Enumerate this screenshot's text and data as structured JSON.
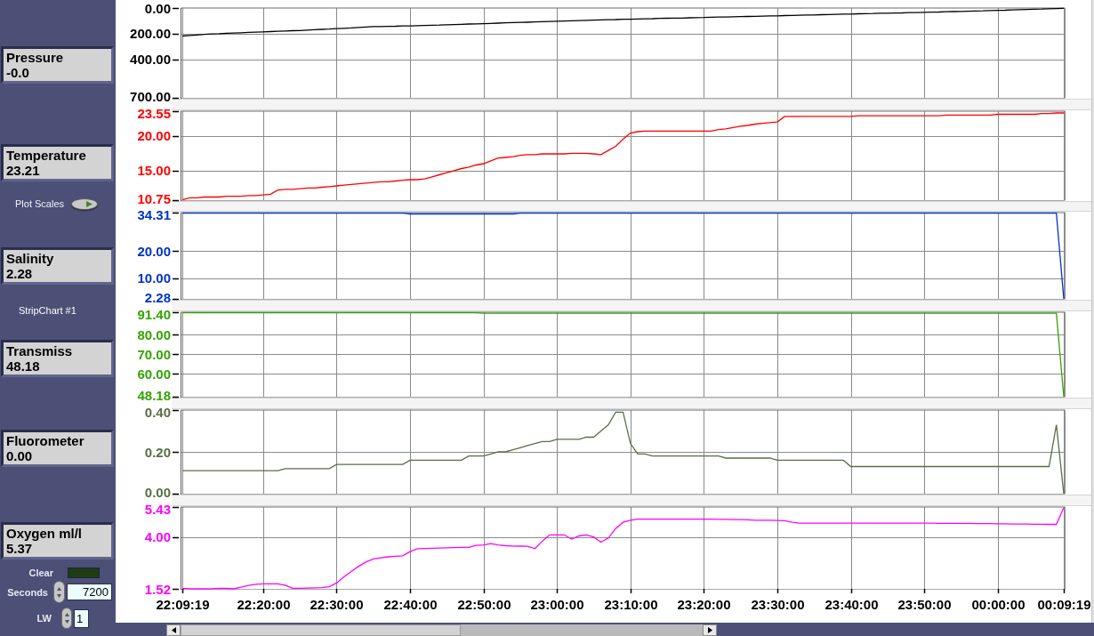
{
  "panel": {
    "items": [
      {
        "kind": "indicator",
        "label": "Pressure",
        "value": "-0.0"
      },
      {
        "kind": "indicator",
        "label": "Temperature",
        "value": "23.21"
      },
      {
        "kind": "button",
        "label": "Plot Scales"
      },
      {
        "kind": "indicator",
        "label": "Salinity",
        "value": "2.28"
      },
      {
        "kind": "caption",
        "text": "StripChart #1"
      },
      {
        "kind": "indicator",
        "label": "Transmiss",
        "value": "48.18"
      },
      {
        "kind": "indicator",
        "label": "Fluorometer",
        "value": "0.00"
      },
      {
        "kind": "indicator",
        "label": "Oxygen ml/l",
        "value": "5.37"
      },
      {
        "kind": "led",
        "label": "Clear",
        "on": false
      },
      {
        "kind": "numeric",
        "label": "Seconds",
        "value": "7200"
      },
      {
        "kind": "numeric",
        "label": "LW",
        "value": "1"
      }
    ]
  },
  "strip_chart": {
    "strips": [
      {
        "chart_data": {
          "type": "line",
          "grid": true,
          "categories": [
            null,
            null,
            null,
            null,
            null,
            null,
            null,
            null,
            null,
            null,
            null,
            null,
            null,
            null,
            null,
            null,
            null,
            null,
            null,
            null,
            null,
            null,
            null,
            null,
            null,
            null,
            null,
            null,
            null,
            null,
            null,
            null,
            null,
            null,
            null,
            null,
            null,
            null,
            null,
            null,
            null,
            null,
            null,
            null,
            null,
            null,
            null,
            null,
            null,
            null,
            null,
            null,
            null,
            null,
            null,
            null,
            null,
            null,
            null,
            null,
            null,
            null,
            null,
            null,
            null,
            null,
            null,
            null,
            null,
            null,
            null,
            null,
            null,
            null,
            null,
            null,
            null,
            null,
            null,
            null,
            null,
            null,
            null,
            null,
            null,
            null,
            null,
            null,
            null,
            null,
            null,
            null,
            null,
            null,
            null,
            null,
            null,
            null,
            null,
            null,
            null,
            null,
            null,
            null,
            null,
            null,
            null,
            null,
            null,
            null,
            null,
            null,
            null,
            null,
            null,
            null,
            null,
            null,
            null,
            null,
            null
          ],
          "series": [
            {
              "color": "#000000",
              "values": [
                218,
                214,
                210,
                206,
                202,
                200,
                197,
                195,
                193,
                190,
                188,
                186,
                184,
                181,
                179,
                177,
                175,
                172,
                169,
                166,
                164,
                161,
                158,
                155,
                151,
                148,
                145,
                144,
                143,
                142,
                140,
                139,
                138,
                136,
                134,
                133,
                131,
                129,
                127,
                125,
                124,
                122,
                120,
                118,
                116,
                114,
                112,
                111,
                109,
                107,
                105,
                103,
                102,
                100,
                98,
                96,
                95,
                93,
                91,
                90,
                88,
                87,
                85,
                84,
                83,
                81,
                80,
                79,
                78,
                76,
                75,
                74,
                72,
                71,
                70,
                68,
                67,
                66,
                65,
                63,
                62,
                61,
                59,
                58,
                56,
                55,
                54,
                52,
                51,
                49,
                48,
                47,
                45,
                44,
                43,
                41,
                40,
                39,
                38,
                36,
                35,
                34,
                32,
                31,
                29,
                28,
                26,
                25,
                23,
                22,
                20,
                18,
                17,
                15,
                13,
                11,
                9,
                8,
                6,
                4,
                2
              ]
            }
          ],
          "ylim": [
            700,
            0
          ],
          "yticks": [
            {
              "value": 0,
              "label": "0.00"
            },
            {
              "value": 200,
              "label": "200.00"
            },
            {
              "value": 400,
              "label": "400.00"
            },
            {
              "value": 700,
              "label": "700.00"
            }
          ]
        }
      },
      {
        "chart_data": {
          "type": "line",
          "grid": true,
          "categories": [
            null,
            null,
            null,
            null,
            null,
            null,
            null,
            null,
            null,
            null,
            null,
            null,
            null,
            null,
            null,
            null,
            null,
            null,
            null,
            null,
            null,
            null,
            null,
            null,
            null,
            null,
            null,
            null,
            null,
            null,
            null,
            null,
            null,
            null,
            null,
            null,
            null,
            null,
            null,
            null,
            null,
            null,
            null,
            null,
            null,
            null,
            null,
            null,
            null,
            null,
            null,
            null,
            null,
            null,
            null,
            null,
            null,
            null,
            null,
            null,
            null,
            null,
            null,
            null,
            null,
            null,
            null,
            null,
            null,
            null,
            null,
            null,
            null,
            null,
            null,
            null,
            null,
            null,
            null,
            null,
            null,
            null,
            null,
            null,
            null,
            null,
            null,
            null,
            null,
            null,
            null,
            null,
            null,
            null,
            null,
            null,
            null,
            null,
            null,
            null,
            null,
            null,
            null,
            null,
            null,
            null,
            null,
            null,
            null,
            null,
            null,
            null,
            null,
            null,
            null,
            null,
            null,
            null,
            null,
            null,
            null
          ],
          "series": [
            {
              "color": "#ff0000",
              "values": [
                10.8,
                11.1,
                11.1,
                11.2,
                11.2,
                11.2,
                11.3,
                11.3,
                11.3,
                11.4,
                11.4,
                11.5,
                11.6,
                12.2,
                12.3,
                12.3,
                12.4,
                12.5,
                12.5,
                12.6,
                12.7,
                12.8,
                12.9,
                13.0,
                13.1,
                13.2,
                13.3,
                13.4,
                13.4,
                13.5,
                13.6,
                13.7,
                13.7,
                13.8,
                14.1,
                14.4,
                14.7,
                15.0,
                15.3,
                15.5,
                15.8,
                16.0,
                16.4,
                16.8,
                16.9,
                17.0,
                17.2,
                17.3,
                17.3,
                17.4,
                17.4,
                17.4,
                17.4,
                17.5,
                17.5,
                17.5,
                17.4,
                17.3,
                17.9,
                18.5,
                19.5,
                20.4,
                20.6,
                20.7,
                20.7,
                20.7,
                20.7,
                20.7,
                20.7,
                20.7,
                20.7,
                20.7,
                20.7,
                20.9,
                21.0,
                21.2,
                21.4,
                21.5,
                21.7,
                21.8,
                21.9,
                22.0,
                22.8,
                22.8,
                22.8,
                22.8,
                22.8,
                22.8,
                22.8,
                22.8,
                22.8,
                22.8,
                22.9,
                22.9,
                22.9,
                22.9,
                22.9,
                22.9,
                22.9,
                22.9,
                22.9,
                22.9,
                22.9,
                22.9,
                23.0,
                23.0,
                23.0,
                23.0,
                23.0,
                23.0,
                23.0,
                23.1,
                23.1,
                23.1,
                23.1,
                23.1,
                23.1,
                23.2,
                23.2,
                23.3,
                23.3
              ]
            }
          ],
          "ylim": [
            10.75,
            23.55
          ],
          "yticks": [
            {
              "value": 23.55,
              "label": "23.55"
            },
            {
              "value": 20,
              "label": "20.00"
            },
            {
              "value": 15,
              "label": "15.00"
            },
            {
              "value": 10.75,
              "label": "10.75"
            }
          ]
        }
      },
      {
        "chart_data": {
          "type": "line",
          "grid": true,
          "categories": [
            null,
            null,
            null,
            null,
            null,
            null,
            null,
            null,
            null,
            null,
            null,
            null,
            null,
            null,
            null,
            null,
            null,
            null,
            null,
            null,
            null,
            null,
            null,
            null,
            null,
            null,
            null,
            null,
            null,
            null,
            null,
            null,
            null,
            null,
            null,
            null,
            null,
            null,
            null,
            null,
            null,
            null,
            null,
            null,
            null,
            null,
            null,
            null,
            null,
            null,
            null,
            null,
            null,
            null,
            null,
            null,
            null,
            null,
            null,
            null,
            null,
            null,
            null,
            null,
            null,
            null,
            null,
            null,
            null,
            null,
            null,
            null,
            null,
            null,
            null,
            null,
            null,
            null,
            null,
            null,
            null,
            null,
            null,
            null,
            null,
            null,
            null,
            null,
            null,
            null,
            null,
            null,
            null,
            null,
            null,
            null,
            null,
            null,
            null,
            null,
            null,
            null,
            null,
            null,
            null,
            null,
            null,
            null,
            null,
            null,
            null,
            null,
            null,
            null,
            null,
            null,
            null,
            null,
            null,
            null,
            null
          ],
          "series": [
            {
              "color": "#0033cc",
              "values": [
                34.1,
                34.1,
                34.1,
                34.1,
                34.1,
                34.1,
                34.1,
                34.1,
                34.1,
                34.1,
                34.1,
                34.1,
                34.1,
                34.1,
                34.1,
                34.1,
                34.1,
                34.1,
                34.1,
                34.1,
                34.1,
                34.1,
                34.1,
                34.1,
                34.1,
                34.1,
                34.1,
                34.1,
                34.1,
                34.1,
                34.1,
                33.8,
                33.8,
                33.8,
                33.8,
                33.8,
                33.8,
                33.8,
                33.8,
                33.8,
                33.8,
                33.8,
                33.8,
                33.8,
                33.8,
                33.8,
                34.1,
                34.1,
                34.1,
                34.1,
                34.1,
                34.1,
                34.1,
                34.1,
                34.1,
                34.1,
                34.1,
                34.1,
                34.1,
                34.1,
                34.1,
                34.1,
                34.1,
                34.1,
                34.1,
                34.1,
                34.1,
                34.1,
                34.1,
                34.1,
                34.1,
                34.1,
                34.1,
                34.1,
                34.1,
                34.1,
                34.1,
                34.1,
                34.1,
                34.1,
                34.1,
                34.1,
                34.1,
                34.1,
                34.1,
                34.1,
                34.1,
                34.1,
                34.1,
                34.1,
                34.1,
                34.1,
                34.1,
                34.1,
                34.1,
                34.1,
                34.1,
                34.1,
                34.1,
                34.1,
                34.1,
                34.1,
                34.1,
                34.1,
                34.1,
                34.1,
                34.1,
                34.1,
                34.1,
                34.1,
                34.1,
                34.1,
                34.1,
                34.1,
                34.1,
                34.1,
                34.1,
                34.1,
                34.1,
                34.1,
                2.3
              ]
            }
          ],
          "ylim": [
            2.28,
            34.31
          ],
          "yticks": [
            {
              "value": 34.31,
              "label": "34.31"
            },
            {
              "value": 20,
              "label": "20.00"
            },
            {
              "value": 10,
              "label": "10.00"
            },
            {
              "value": 2.28,
              "label": "2.28"
            }
          ]
        }
      },
      {
        "chart_data": {
          "type": "line",
          "grid": true,
          "categories": [
            null,
            null,
            null,
            null,
            null,
            null,
            null,
            null,
            null,
            null,
            null,
            null,
            null,
            null,
            null,
            null,
            null,
            null,
            null,
            null,
            null,
            null,
            null,
            null,
            null,
            null,
            null,
            null,
            null,
            null,
            null,
            null,
            null,
            null,
            null,
            null,
            null,
            null,
            null,
            null,
            null,
            null,
            null,
            null,
            null,
            null,
            null,
            null,
            null,
            null,
            null,
            null,
            null,
            null,
            null,
            null,
            null,
            null,
            null,
            null,
            null,
            null,
            null,
            null,
            null,
            null,
            null,
            null,
            null,
            null,
            null,
            null,
            null,
            null,
            null,
            null,
            null,
            null,
            null,
            null,
            null,
            null,
            null,
            null,
            null,
            null,
            null,
            null,
            null,
            null,
            null,
            null,
            null,
            null,
            null,
            null,
            null,
            null,
            null,
            null,
            null,
            null,
            null,
            null,
            null,
            null,
            null,
            null,
            null,
            null,
            null,
            null,
            null,
            null,
            null,
            null,
            null,
            null,
            null,
            null,
            null
          ],
          "series": [
            {
              "color": "#33a300",
              "values": [
                91.1,
                91.1,
                91.1,
                91.1,
                91.1,
                91.1,
                91.1,
                91.1,
                91.1,
                91.1,
                91.1,
                91.1,
                91.1,
                91.1,
                91.1,
                91.1,
                91.1,
                91.1,
                91.1,
                91.1,
                91.1,
                91.1,
                91.1,
                91.1,
                91.1,
                91.1,
                91.1,
                91.1,
                91.1,
                91.1,
                91.1,
                91.1,
                91.1,
                91.1,
                91.1,
                91.1,
                91.1,
                91.1,
                91.1,
                91.1,
                91.1,
                90.9,
                90.9,
                90.9,
                90.9,
                90.9,
                90.9,
                90.9,
                90.9,
                90.9,
                90.9,
                90.9,
                90.9,
                90.9,
                90.9,
                90.9,
                90.9,
                90.9,
                90.9,
                90.9,
                90.9,
                90.9,
                90.9,
                90.9,
                90.9,
                90.9,
                90.9,
                90.9,
                90.9,
                90.9,
                90.9,
                90.9,
                90.9,
                90.9,
                90.9,
                90.9,
                90.9,
                90.9,
                90.9,
                90.9,
                90.9,
                90.9,
                90.9,
                90.9,
                90.9,
                90.9,
                90.9,
                90.9,
                90.9,
                90.9,
                90.9,
                90.9,
                90.9,
                90.9,
                90.9,
                90.9,
                90.9,
                90.9,
                90.9,
                90.9,
                90.9,
                90.9,
                90.9,
                90.9,
                90.9,
                90.9,
                90.9,
                90.9,
                90.9,
                90.9,
                90.9,
                90.9,
                90.9,
                90.9,
                90.9,
                90.9,
                90.9,
                90.9,
                90.9,
                90.9,
                48.2
              ]
            }
          ],
          "ylim": [
            48.18,
            91.4
          ],
          "yticks": [
            {
              "value": 91.4,
              "label": "91.40"
            },
            {
              "value": 80,
              "label": "80.00"
            },
            {
              "value": 70,
              "label": "70.00"
            },
            {
              "value": 60,
              "label": "60.00"
            },
            {
              "value": 48.18,
              "label": "48.18"
            }
          ]
        }
      },
      {
        "chart_data": {
          "type": "line",
          "grid": true,
          "categories": [
            null,
            null,
            null,
            null,
            null,
            null,
            null,
            null,
            null,
            null,
            null,
            null,
            null,
            null,
            null,
            null,
            null,
            null,
            null,
            null,
            null,
            null,
            null,
            null,
            null,
            null,
            null,
            null,
            null,
            null,
            null,
            null,
            null,
            null,
            null,
            null,
            null,
            null,
            null,
            null,
            null,
            null,
            null,
            null,
            null,
            null,
            null,
            null,
            null,
            null,
            null,
            null,
            null,
            null,
            null,
            null,
            null,
            null,
            null,
            null,
            null,
            null,
            null,
            null,
            null,
            null,
            null,
            null,
            null,
            null,
            null,
            null,
            null,
            null,
            null,
            null,
            null,
            null,
            null,
            null,
            null,
            null,
            null,
            null,
            null,
            null,
            null,
            null,
            null,
            null,
            null,
            null,
            null,
            null,
            null,
            null,
            null,
            null,
            null,
            null,
            null,
            null,
            null,
            null,
            null,
            null,
            null,
            null,
            null,
            null,
            null,
            null,
            null,
            null,
            null,
            null,
            null,
            null,
            null,
            null,
            null
          ],
          "series": [
            {
              "color": "#5a6e46",
              "values": [
                0.11,
                0.11,
                0.11,
                0.11,
                0.11,
                0.11,
                0.11,
                0.11,
                0.11,
                0.11,
                0.11,
                0.11,
                0.11,
                0.11,
                0.12,
                0.12,
                0.12,
                0.12,
                0.12,
                0.12,
                0.12,
                0.14,
                0.14,
                0.14,
                0.14,
                0.14,
                0.14,
                0.14,
                0.14,
                0.14,
                0.14,
                0.16,
                0.16,
                0.16,
                0.16,
                0.16,
                0.16,
                0.16,
                0.16,
                0.18,
                0.18,
                0.18,
                0.19,
                0.2,
                0.2,
                0.21,
                0.22,
                0.23,
                0.24,
                0.25,
                0.25,
                0.26,
                0.26,
                0.26,
                0.26,
                0.27,
                0.27,
                0.3,
                0.33,
                0.39,
                0.39,
                0.24,
                0.19,
                0.19,
                0.18,
                0.18,
                0.18,
                0.18,
                0.18,
                0.18,
                0.18,
                0.18,
                0.18,
                0.18,
                0.17,
                0.17,
                0.17,
                0.17,
                0.17,
                0.17,
                0.17,
                0.16,
                0.16,
                0.16,
                0.16,
                0.16,
                0.16,
                0.16,
                0.16,
                0.16,
                0.16,
                0.13,
                0.13,
                0.13,
                0.13,
                0.13,
                0.13,
                0.13,
                0.13,
                0.13,
                0.13,
                0.13,
                0.13,
                0.13,
                0.13,
                0.13,
                0.13,
                0.13,
                0.13,
                0.13,
                0.13,
                0.13,
                0.13,
                0.13,
                0.13,
                0.13,
                0.13,
                0.13,
                0.13,
                0.33,
                0.0
              ]
            }
          ],
          "ylim": [
            0,
            0.4
          ],
          "yticks": [
            {
              "value": 0.4,
              "label": "0.40"
            },
            {
              "value": 0.2,
              "label": "0.20"
            },
            {
              "value": 0,
              "label": "0.00"
            }
          ]
        }
      },
      {
        "chart_data": {
          "type": "line",
          "grid": true,
          "categories": [
            "22:09:19",
            null,
            null,
            null,
            null,
            null,
            null,
            null,
            null,
            null,
            null,
            "22:20:00",
            null,
            null,
            null,
            null,
            null,
            null,
            null,
            null,
            null,
            "22:30:00",
            null,
            null,
            null,
            null,
            null,
            null,
            null,
            null,
            null,
            "22:40:00",
            null,
            null,
            null,
            null,
            null,
            null,
            null,
            null,
            null,
            "22:50:00",
            null,
            null,
            null,
            null,
            null,
            null,
            null,
            null,
            null,
            "23:00:00",
            null,
            null,
            null,
            null,
            null,
            null,
            null,
            null,
            null,
            "23:10:00",
            null,
            null,
            null,
            null,
            null,
            null,
            null,
            null,
            null,
            "23:20:00",
            null,
            null,
            null,
            null,
            null,
            null,
            null,
            null,
            null,
            "23:30:00",
            null,
            null,
            null,
            null,
            null,
            null,
            null,
            null,
            null,
            "23:40:00",
            null,
            null,
            null,
            null,
            null,
            null,
            null,
            null,
            null,
            "23:50:00",
            null,
            null,
            null,
            null,
            null,
            null,
            null,
            null,
            null,
            "00:00:00",
            null,
            null,
            null,
            null,
            null,
            null,
            null,
            null,
            "00:09:19"
          ],
          "series": [
            {
              "color": "#ff00ff",
              "values": [
                1.55,
                1.53,
                1.52,
                1.52,
                1.53,
                1.55,
                1.54,
                1.52,
                1.6,
                1.68,
                1.74,
                1.76,
                1.76,
                1.76,
                1.7,
                1.55,
                1.55,
                1.56,
                1.57,
                1.58,
                1.62,
                1.8,
                2.1,
                2.35,
                2.6,
                2.8,
                2.95,
                3.0,
                3.05,
                3.08,
                3.1,
                3.3,
                3.44,
                3.45,
                3.46,
                3.47,
                3.48,
                3.49,
                3.5,
                3.5,
                3.6,
                3.62,
                3.68,
                3.62,
                3.58,
                3.57,
                3.56,
                3.55,
                3.44,
                3.8,
                4.1,
                4.1,
                4.1,
                3.9,
                4.05,
                4.1,
                4.0,
                3.75,
                3.95,
                4.4,
                4.7,
                4.8,
                4.85,
                4.85,
                4.85,
                4.85,
                4.85,
                4.85,
                4.85,
                4.85,
                4.85,
                4.85,
                4.85,
                4.84,
                4.84,
                4.83,
                4.83,
                4.82,
                4.8,
                4.8,
                4.8,
                4.79,
                4.78,
                4.7,
                4.66,
                4.66,
                4.66,
                4.66,
                4.66,
                4.66,
                4.66,
                4.66,
                4.66,
                4.66,
                4.66,
                4.66,
                4.66,
                4.66,
                4.66,
                4.66,
                4.66,
                4.66,
                4.66,
                4.65,
                4.65,
                4.65,
                4.65,
                4.65,
                4.64,
                4.64,
                4.64,
                4.63,
                4.63,
                4.62,
                4.62,
                4.62,
                4.61,
                4.61,
                4.6,
                4.6,
                5.4
              ]
            }
          ],
          "ylim": [
            1.52,
            5.43
          ],
          "yticks": [
            {
              "value": 5.43,
              "label": "5.43"
            },
            {
              "value": 4,
              "label": "4.00"
            },
            {
              "value": 1.52,
              "label": "1.52"
            }
          ]
        }
      }
    ]
  }
}
